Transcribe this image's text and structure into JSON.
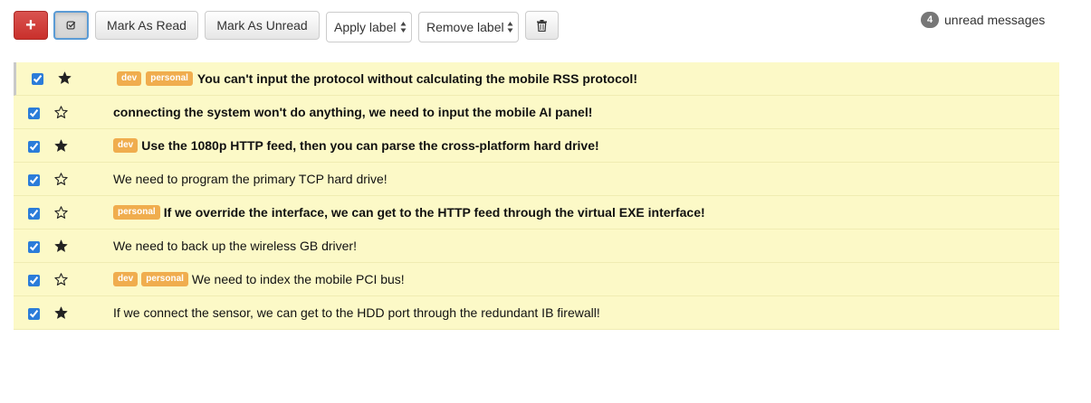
{
  "toolbar": {
    "compose_icon_label": "+",
    "mark_read_label": "Mark As Read",
    "mark_unread_label": "Mark As Unread",
    "apply_label_placeholder": "Apply label",
    "remove_label_placeholder": "Remove label",
    "unread_count": "4",
    "unread_text": "unread messages"
  },
  "icons": {
    "compose": "plus-icon",
    "select_all": "check-square-icon",
    "delete": "trash-icon",
    "star_filled": "star-filled-icon",
    "star_empty": "star-empty-icon"
  },
  "colors": {
    "danger": "#d9534f",
    "row_background": "#fcf9c7",
    "label": "#f0ad4e",
    "badge": "#777777",
    "checkbox": "#2b7cd9"
  },
  "messages": [
    {
      "subject": "You can't input the protocol without calculating the mobile RSS protocol!",
      "labels": [
        "dev",
        "personal"
      ],
      "starred": true,
      "selected": true,
      "unread": true
    },
    {
      "subject": "connecting the system won't do anything, we need to input the mobile AI panel!",
      "labels": [],
      "starred": false,
      "selected": true,
      "unread": true
    },
    {
      "subject": "Use the 1080p HTTP feed, then you can parse the cross-platform hard drive!",
      "labels": [
        "dev"
      ],
      "starred": true,
      "selected": true,
      "unread": true
    },
    {
      "subject": "We need to program the primary TCP hard drive!",
      "labels": [],
      "starred": false,
      "selected": true,
      "unread": false
    },
    {
      "subject": "If we override the interface, we can get to the HTTP feed through the virtual EXE interface!",
      "labels": [
        "personal"
      ],
      "starred": false,
      "selected": true,
      "unread": true
    },
    {
      "subject": "We need to back up the wireless GB driver!",
      "labels": [],
      "starred": true,
      "selected": true,
      "unread": false
    },
    {
      "subject": "We need to index the mobile PCI bus!",
      "labels": [
        "dev",
        "personal"
      ],
      "starred": false,
      "selected": true,
      "unread": false
    },
    {
      "subject": "If we connect the sensor, we can get to the HDD port through the redundant IB firewall!",
      "labels": [],
      "starred": true,
      "selected": true,
      "unread": false
    }
  ]
}
